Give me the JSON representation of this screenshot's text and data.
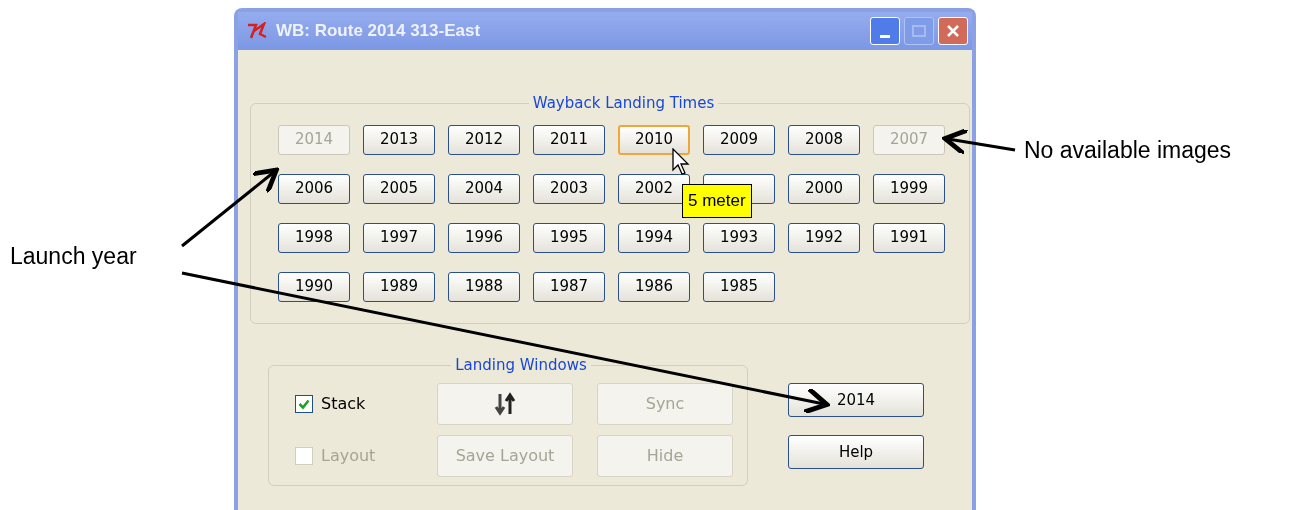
{
  "window": {
    "title": "WB: Route 2014 313-East"
  },
  "wayback_landing_times": {
    "title": "Wayback Landing Times",
    "years": [
      {
        "kind": "year",
        "label": "2014",
        "disabled": true,
        "hovered": false
      },
      {
        "kind": "year",
        "label": "2013",
        "disabled": false,
        "hovered": false
      },
      {
        "kind": "year",
        "label": "2012",
        "disabled": false,
        "hovered": false
      },
      {
        "kind": "year",
        "label": "2011",
        "disabled": false,
        "hovered": false
      },
      {
        "kind": "year",
        "label": "2010",
        "disabled": false,
        "hovered": true
      },
      {
        "kind": "year",
        "label": "2009",
        "disabled": false,
        "hovered": false
      },
      {
        "kind": "year",
        "label": "2008",
        "disabled": false,
        "hovered": false
      },
      {
        "kind": "year",
        "label": "2007",
        "disabled": true,
        "hovered": false
      },
      {
        "kind": "year",
        "label": "2006",
        "disabled": false,
        "hovered": false
      },
      {
        "kind": "year",
        "label": "2005",
        "disabled": false,
        "hovered": false
      },
      {
        "kind": "year",
        "label": "2004",
        "disabled": false,
        "hovered": false
      },
      {
        "kind": "year",
        "label": "2003",
        "disabled": false,
        "hovered": false
      },
      {
        "kind": "year",
        "label": "2002",
        "disabled": false,
        "hovered": false
      },
      {
        "kind": "covered",
        "disabled": false,
        "hovered": false
      },
      {
        "kind": "year",
        "label": "2000",
        "disabled": false,
        "hovered": false
      },
      {
        "kind": "year",
        "label": "1999",
        "disabled": false,
        "hovered": false
      },
      {
        "kind": "year",
        "label": "1998",
        "disabled": false,
        "hovered": false
      },
      {
        "kind": "year",
        "label": "1997",
        "disabled": false,
        "hovered": false
      },
      {
        "kind": "year",
        "label": "1996",
        "disabled": false,
        "hovered": false
      },
      {
        "kind": "year",
        "label": "1995",
        "disabled": false,
        "hovered": false
      },
      {
        "kind": "year",
        "label": "1994",
        "disabled": false,
        "hovered": false
      },
      {
        "kind": "year",
        "label": "1993",
        "disabled": false,
        "hovered": false
      },
      {
        "kind": "year",
        "label": "1992",
        "disabled": false,
        "hovered": false
      },
      {
        "kind": "year",
        "label": "1991",
        "disabled": false,
        "hovered": false
      },
      {
        "kind": "year",
        "label": "1990",
        "disabled": false,
        "hovered": false
      },
      {
        "kind": "year",
        "label": "1989",
        "disabled": false,
        "hovered": false
      },
      {
        "kind": "year",
        "label": "1988",
        "disabled": false,
        "hovered": false
      },
      {
        "kind": "year",
        "label": "1987",
        "disabled": false,
        "hovered": false
      },
      {
        "kind": "year",
        "label": "1986",
        "disabled": false,
        "hovered": false
      },
      {
        "kind": "year",
        "label": "1985",
        "disabled": false,
        "hovered": false
      }
    ]
  },
  "tooltip": {
    "text": "5 meter"
  },
  "landing_windows": {
    "title": "Landing Windows",
    "rows": [
      {
        "checkbox": {
          "label": "Stack",
          "checked": true,
          "disabled": false
        },
        "buttons": [
          {
            "kind": "icon",
            "disabled": false
          },
          {
            "kind": "text",
            "label": "Sync",
            "disabled": true
          }
        ]
      },
      {
        "checkbox": {
          "label": "Layout",
          "checked": false,
          "disabled": true
        },
        "buttons": [
          {
            "kind": "text",
            "label": "Save Layout",
            "disabled": true
          },
          {
            "kind": "text",
            "label": "Hide",
            "disabled": true
          }
        ]
      }
    ]
  },
  "side_buttons": [
    {
      "label": "2014"
    },
    {
      "label": "Help"
    }
  ],
  "annotations": [
    {
      "text": "No available images"
    },
    {
      "text": "Launch year"
    }
  ]
}
